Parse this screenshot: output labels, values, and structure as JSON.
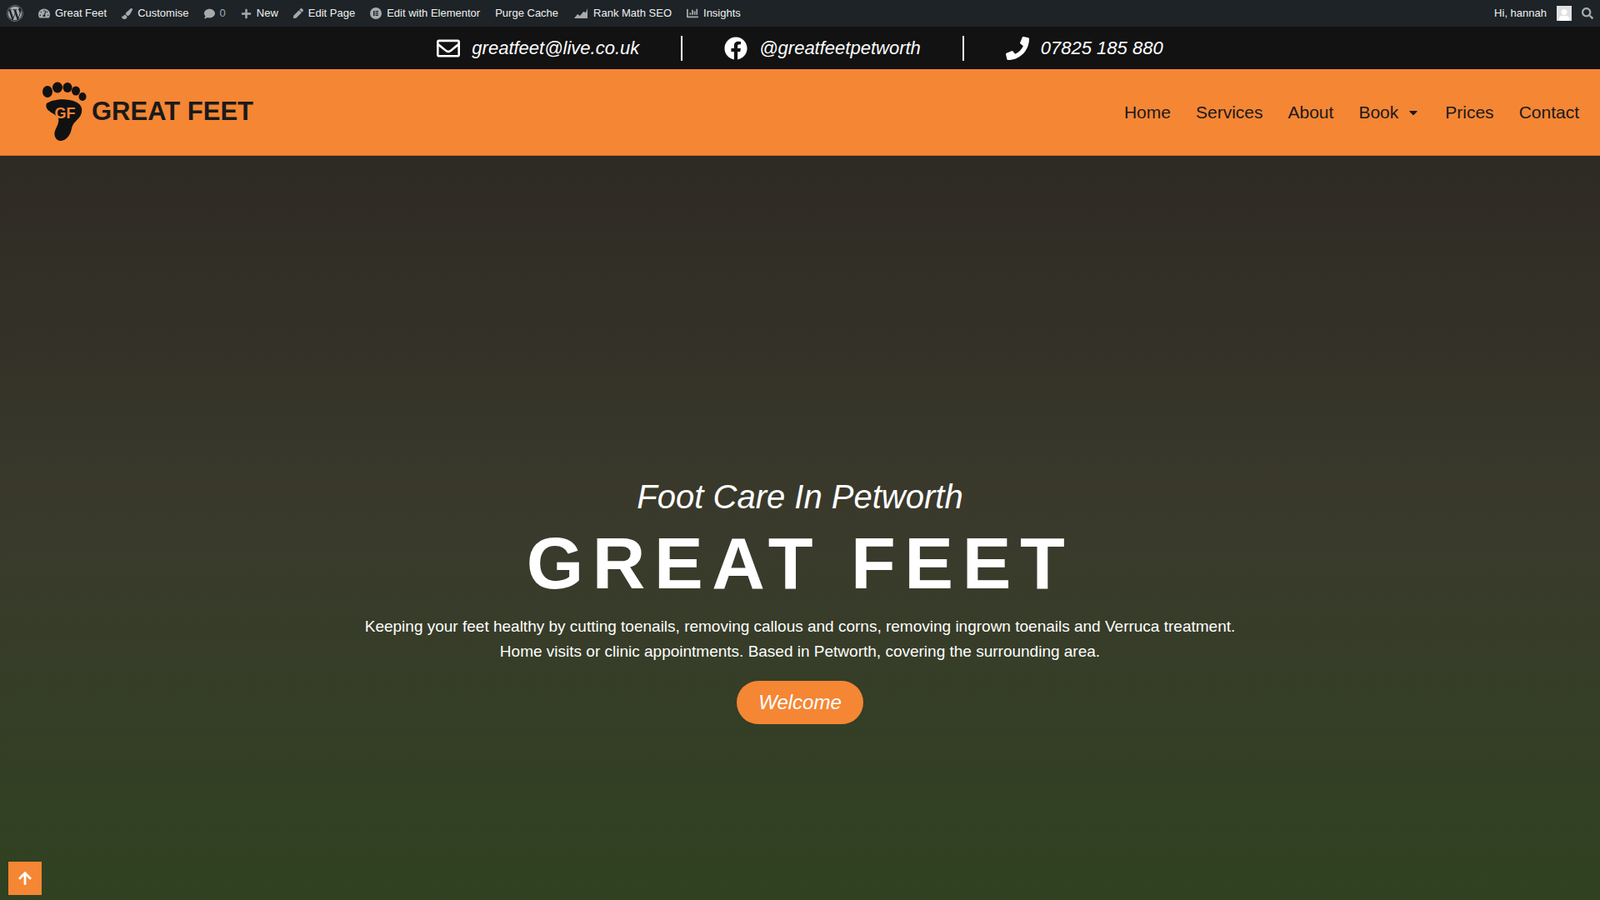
{
  "admin_bar": {
    "items": [
      {
        "label": "Great Feet"
      },
      {
        "label": "Customise"
      },
      {
        "label": "0"
      },
      {
        "label": "New"
      },
      {
        "label": "Edit Page"
      },
      {
        "label": "Edit with Elementor"
      },
      {
        "label": "Purge Cache"
      },
      {
        "label": "Rank Math SEO"
      },
      {
        "label": "Insights"
      }
    ],
    "greeting": "Hi, hannah"
  },
  "contact_bar": {
    "email": "greatfeet@live.co.uk",
    "facebook": "@greatfeetpetworth",
    "phone": "07825 185 880"
  },
  "header": {
    "logo_initials": "GF",
    "logo_text": "GREAT FEET",
    "nav": [
      {
        "label": "Home",
        "dropdown": false
      },
      {
        "label": "Services",
        "dropdown": false
      },
      {
        "label": "About",
        "dropdown": false
      },
      {
        "label": "Book",
        "dropdown": true
      },
      {
        "label": "Prices",
        "dropdown": false
      },
      {
        "label": "Contact",
        "dropdown": false
      }
    ]
  },
  "hero": {
    "subtitle": "Foot Care In Petworth",
    "title": "GREAT FEET",
    "lines": [
      "Keeping your feet healthy by cutting toenails, removing callous and corns, removing ingrown toenails and Verruca treatment.",
      "Home visits or clinic appointments. Based in Petworth, covering the surrounding area."
    ],
    "button": "Welcome"
  }
}
